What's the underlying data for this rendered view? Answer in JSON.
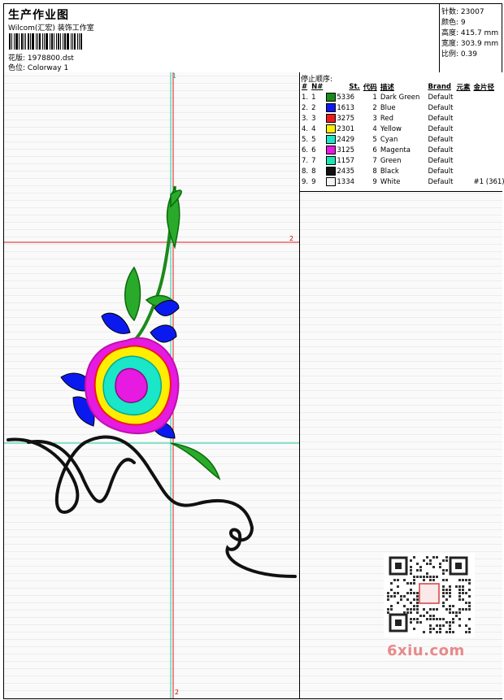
{
  "header": {
    "title": "生产作业图",
    "studio": "Wilcom(汇宏) 装饰工作室",
    "design_label": "花版:",
    "design_file": "1978800.dst",
    "colorway_label": "色位:",
    "colorway": "Colorway 1"
  },
  "stats": {
    "stitches_label": "针数:",
    "stitches": "23007",
    "colors_label": "颜色:",
    "colors": "9",
    "height_label": "高度:",
    "height": "415.7 mm",
    "width_label": "宽度:",
    "width": "303.9 mm",
    "scale_label": "比例:",
    "scale": "0.39"
  },
  "stop_sequence": {
    "title": "停止顺序:",
    "headers": [
      "#",
      "N#",
      "St.",
      "代码",
      "描述",
      "Brand",
      "元素",
      "金片径"
    ],
    "rows": [
      {
        "n": "1.",
        "nn": "1",
        "color": "#1a8a1a",
        "st": "5336",
        "code": "1",
        "desc": "Dark Green",
        "brand": "Default",
        "extra": ""
      },
      {
        "n": "2.",
        "nn": "2",
        "color": "#0a1aee",
        "st": "1613",
        "code": "2",
        "desc": "Blue",
        "brand": "Default",
        "extra": ""
      },
      {
        "n": "3.",
        "nn": "3",
        "color": "#ee1a1a",
        "st": "3275",
        "code": "3",
        "desc": "Red",
        "brand": "Default",
        "extra": ""
      },
      {
        "n": "4.",
        "nn": "4",
        "color": "#ffee00",
        "st": "2301",
        "code": "4",
        "desc": "Yellow",
        "brand": "Default",
        "extra": ""
      },
      {
        "n": "5.",
        "nn": "5",
        "color": "#1ae6c8",
        "st": "2429",
        "code": "5",
        "desc": "Cyan",
        "brand": "Default",
        "extra": ""
      },
      {
        "n": "6.",
        "nn": "6",
        "color": "#e61ae0",
        "st": "3125",
        "code": "6",
        "desc": "Magenta",
        "brand": "Default",
        "extra": ""
      },
      {
        "n": "7.",
        "nn": "7",
        "color": "#1ae6b4",
        "st": "1157",
        "code": "7",
        "desc": "Green",
        "brand": "Default",
        "extra": ""
      },
      {
        "n": "8.",
        "nn": "8",
        "color": "#111111",
        "st": "2435",
        "code": "8",
        "desc": "Black",
        "brand": "Default",
        "extra": ""
      },
      {
        "n": "9.",
        "nn": "9",
        "color": "#f4f4f4",
        "st": "1334",
        "code": "9",
        "desc": "White",
        "brand": "Default",
        "extra": "#1 (361)"
      }
    ]
  },
  "guides": {
    "v_top": "1",
    "h_mid": "2",
    "v_bottom": "2"
  },
  "watermark": "6xiu.com"
}
